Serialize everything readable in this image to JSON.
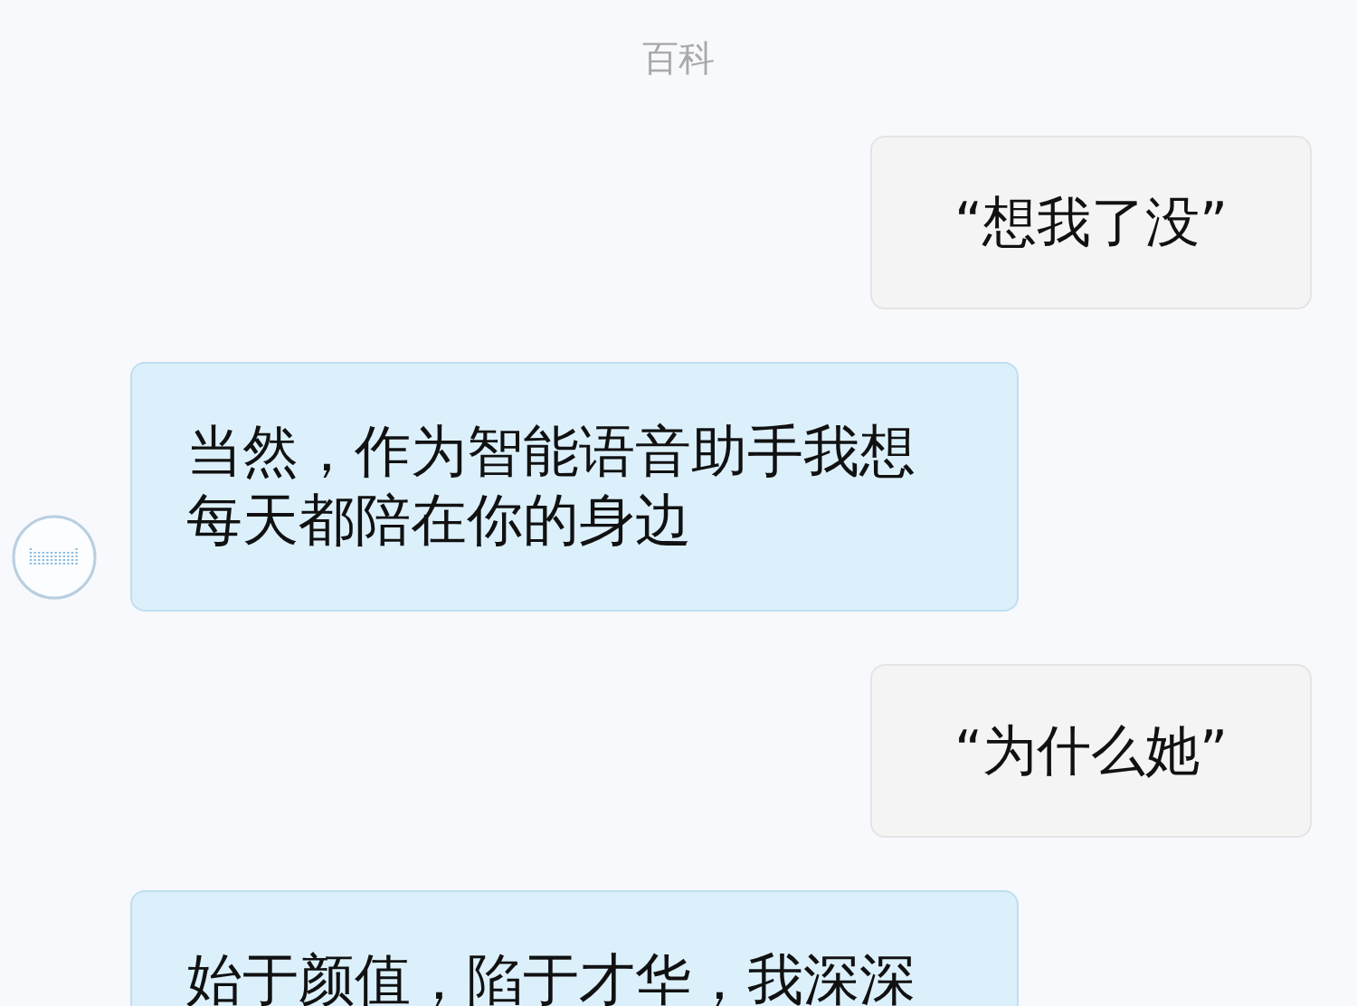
{
  "header": {
    "title": "百科"
  },
  "messages": [
    {
      "kind": "user",
      "text": "“想我了没”"
    },
    {
      "kind": "bot",
      "text": "当然，作为智能语音助手我想每天都陪在你的身边",
      "avatar": true
    },
    {
      "kind": "user",
      "text": "“为什么她”"
    },
    {
      "kind": "bot",
      "text": "始于颜值，陷于才华，我深深",
      "avatar": false
    }
  ]
}
